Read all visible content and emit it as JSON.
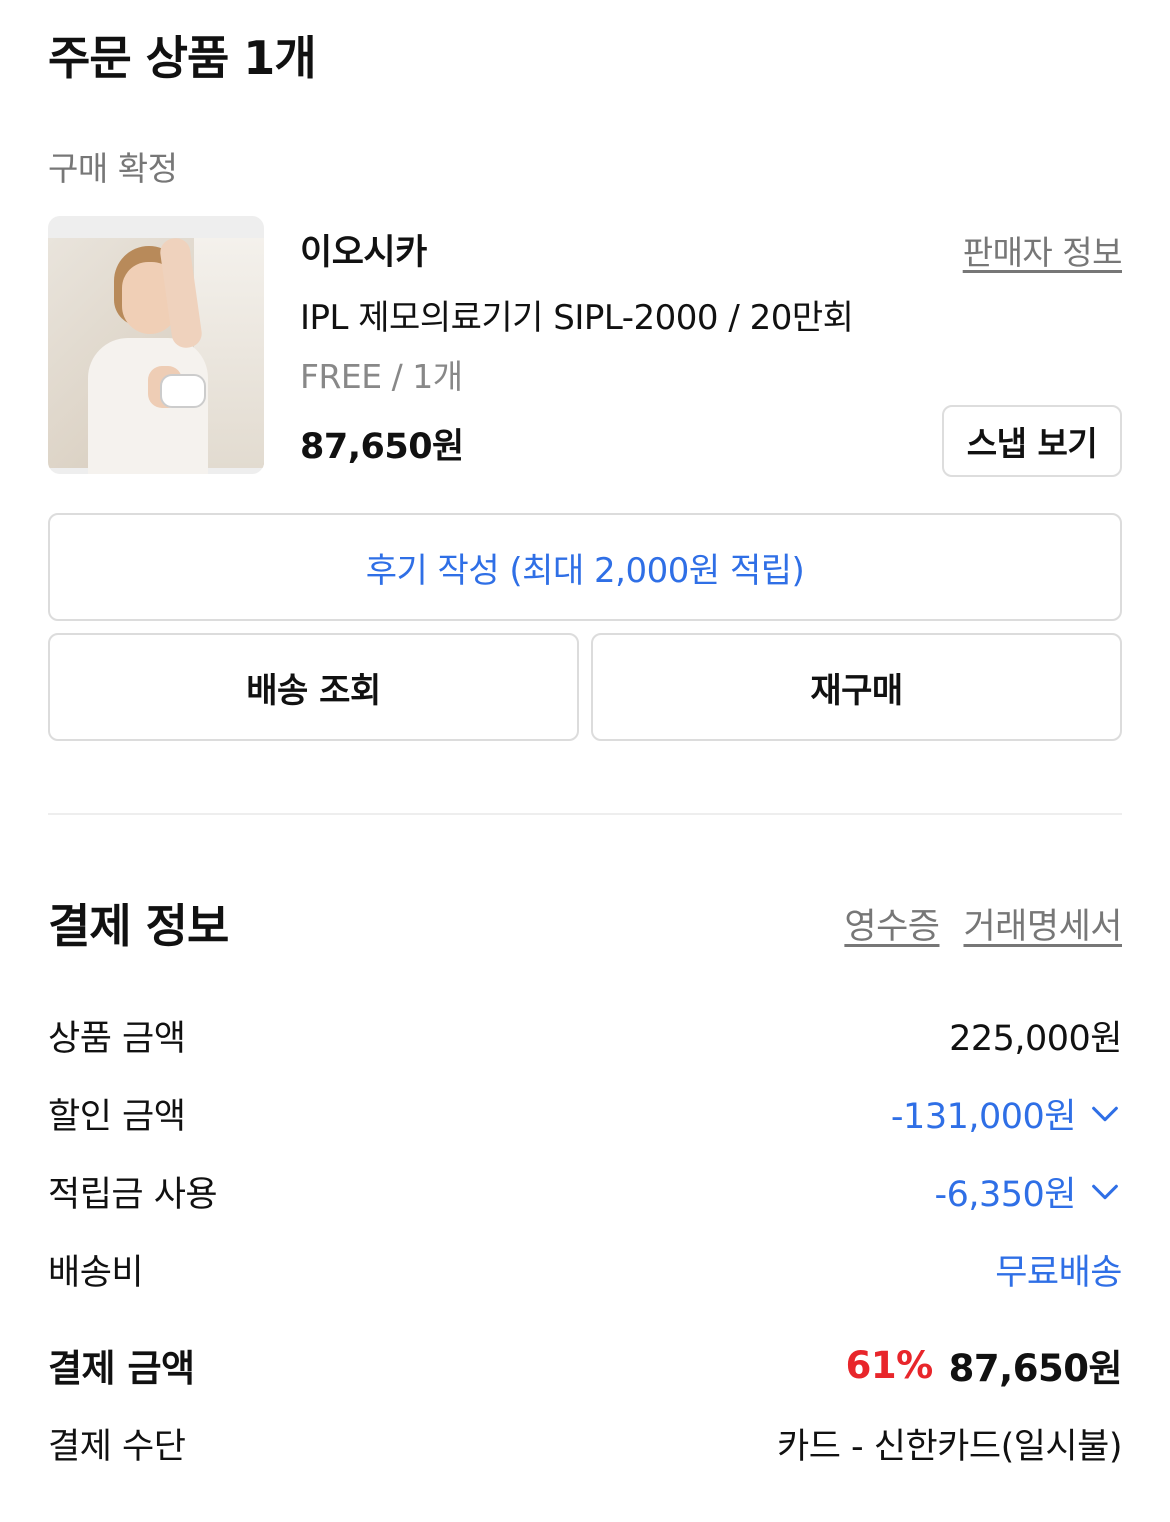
{
  "order": {
    "title": "주문 상품 1개",
    "status": "구매 확정",
    "brand": "이오시카",
    "seller_info_label": "판매자 정보",
    "product_name": "IPL 제모의료기기 SIPL-2000 / 20만회",
    "option": "FREE / 1개",
    "price": "87,650원",
    "snap_label": "스냅 보기",
    "review_button": "후기 작성 (최대 2,000원 적립)",
    "track_button": "배송 조회",
    "rebuy_button": "재구매"
  },
  "payment": {
    "title": "결제 정보",
    "receipt_link": "영수증",
    "statement_link": "거래명세서",
    "rows": {
      "product_amount": {
        "label": "상품 금액",
        "value": "225,000원"
      },
      "discount": {
        "label": "할인 금액",
        "value": "-131,000원"
      },
      "points": {
        "label": "적립금 사용",
        "value": "-6,350원"
      },
      "shipping": {
        "label": "배송비",
        "value": "무료배송"
      },
      "total": {
        "label": "결제 금액",
        "rate": "61%",
        "value": "87,650원"
      },
      "method": {
        "label": "결제 수단",
        "value": "카드 - 신한카드(일시불)"
      }
    }
  },
  "colors": {
    "accent_blue": "#2f6fe6",
    "discount_red": "#e8262b",
    "muted_text": "#777777"
  },
  "icons": [
    "chevron-down-icon"
  ]
}
